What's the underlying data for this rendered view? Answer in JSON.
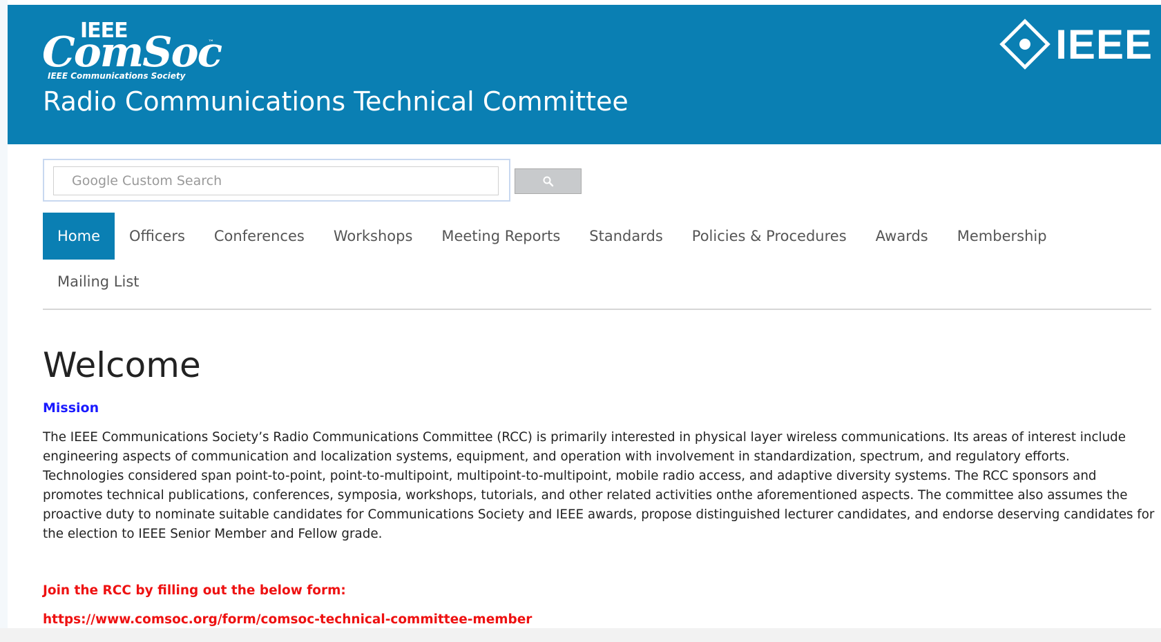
{
  "header": {
    "logo_top": "IEEE",
    "logo_word": "ComSoc",
    "logo_tm": "™",
    "logo_sub": "IEEE Communications Society",
    "title": "Radio Communications Technical Committee",
    "ieee_logo_text": "IEEE",
    "background_color": "#0a7fb3"
  },
  "search": {
    "placeholder": "Google Custom Search",
    "value": "",
    "button_icon": "search-icon"
  },
  "nav": {
    "items": [
      {
        "label": "Home",
        "active": true
      },
      {
        "label": "Officers"
      },
      {
        "label": "Conferences"
      },
      {
        "label": "Workshops"
      },
      {
        "label": "Meeting Reports"
      },
      {
        "label": "Standards"
      },
      {
        "label": "Policies & Procedures"
      },
      {
        "label": "Awards"
      },
      {
        "label": "Membership"
      },
      {
        "label": "Mailing List"
      }
    ]
  },
  "main": {
    "heading": "Welcome",
    "mission_label": "Mission",
    "mission_text": "The IEEE Communications Society’s Radio Communications Committee (RCC) is primarily interested in physical layer wireless communications. Its areas of interest include engineering aspects of communication and localization systems, equipment, and operation with involvement in standardization, spectrum, and regulatory efforts. Technologies considered span point-to-point, point-to-multipoint, multipoint-to-multipoint, mobile radio access, and adaptive diversity systems. The RCC sponsors and promotes technical publications, conferences, symposia, workshops, tutorials, and other related activities onthe aforementioned aspects. The committee also assumes the proactive duty to nominate suitable candidates for Communications Society and IEEE awards, propose distinguished lecturer candidates, and endorse deserving candidates for the election to IEEE Senior Member and Fellow grade.",
    "join_text": "Join the RCC by filling out the below form:",
    "form_url": "https://www.comsoc.org/form/comsoc-technical-committee-member"
  },
  "colors": {
    "accent": "#0a7fb3",
    "mission_link": "#1a1aff",
    "join_red": "#ee1111"
  }
}
